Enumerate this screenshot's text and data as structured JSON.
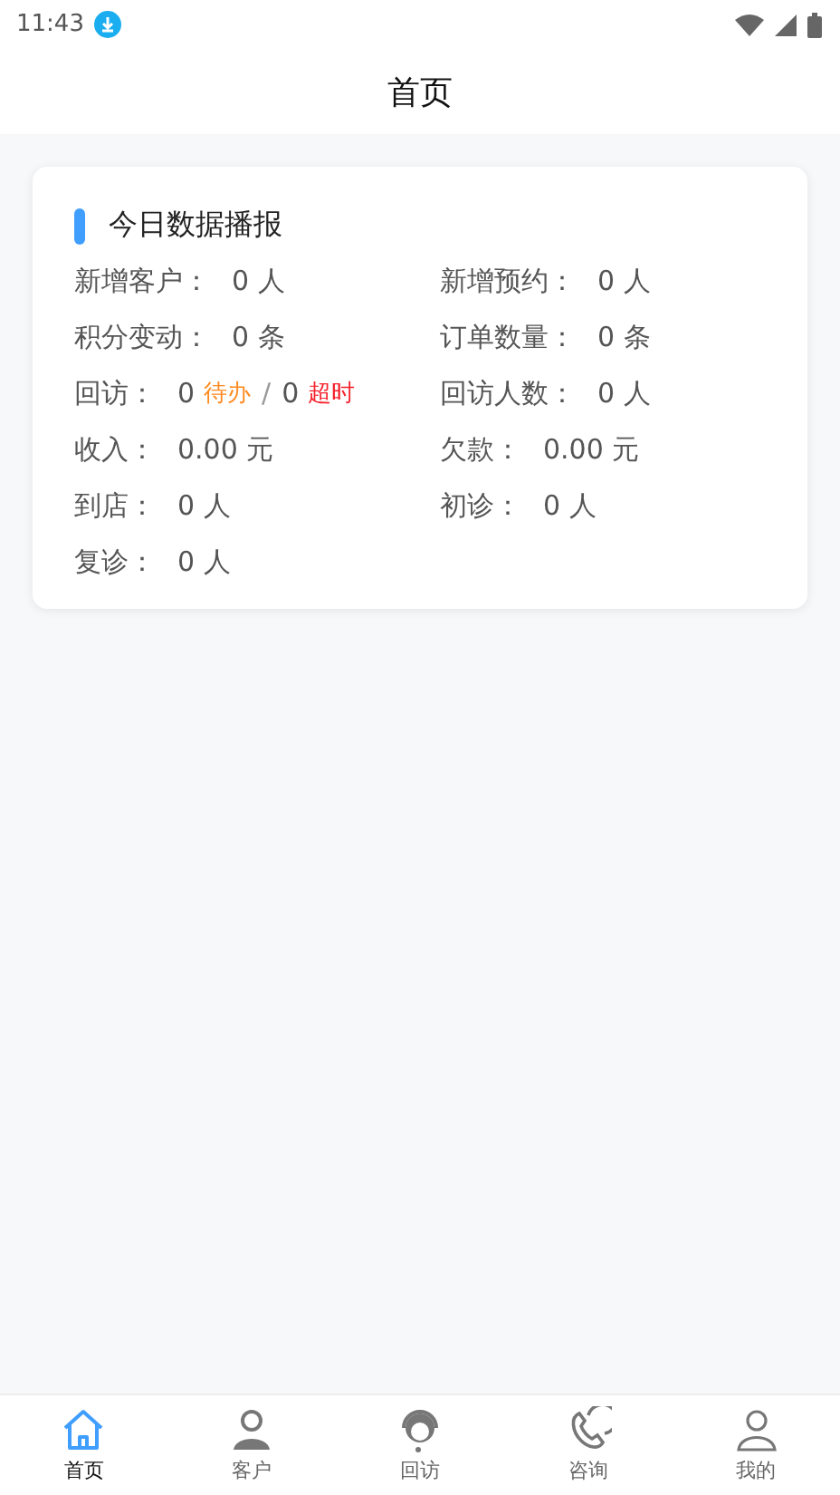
{
  "status_bar": {
    "time": "11:43"
  },
  "header": {
    "title": "首页"
  },
  "card": {
    "title": "今日数据播报",
    "stats": [
      {
        "kind": "plain",
        "label": "新增客户：",
        "value": "0",
        "unit": "人"
      },
      {
        "kind": "plain",
        "label": "新增预约：",
        "value": "0",
        "unit": "人"
      },
      {
        "kind": "plain",
        "label": "积分变动：",
        "value": "0",
        "unit": "条"
      },
      {
        "kind": "plain",
        "label": "订单数量：",
        "value": "0",
        "unit": "条"
      },
      {
        "kind": "split",
        "label": "回访：",
        "parts": [
          {
            "value": "0",
            "tag": "待办",
            "color": "#ff8a1f"
          },
          {
            "value": "0",
            "tag": "超时",
            "color": "#f5222d"
          }
        ],
        "separator": "/"
      },
      {
        "kind": "plain",
        "label": "回访人数：",
        "value": "0",
        "unit": "人"
      },
      {
        "kind": "plain",
        "label": "收入：",
        "value": "0.00",
        "unit": "元"
      },
      {
        "kind": "plain",
        "label": "欠款：",
        "value": "0.00",
        "unit": "元"
      },
      {
        "kind": "plain",
        "label": "到店：",
        "value": "0",
        "unit": "人"
      },
      {
        "kind": "plain",
        "label": "初诊：",
        "value": "0",
        "unit": "人"
      },
      {
        "kind": "plain",
        "label": "复诊：",
        "value": "0",
        "unit": "人"
      }
    ]
  },
  "tabs": [
    {
      "label": "首页",
      "selected": true
    },
    {
      "label": "客户",
      "selected": false
    },
    {
      "label": "回访",
      "selected": false
    },
    {
      "label": "咨询",
      "selected": false
    },
    {
      "label": "我的",
      "selected": false
    }
  ]
}
